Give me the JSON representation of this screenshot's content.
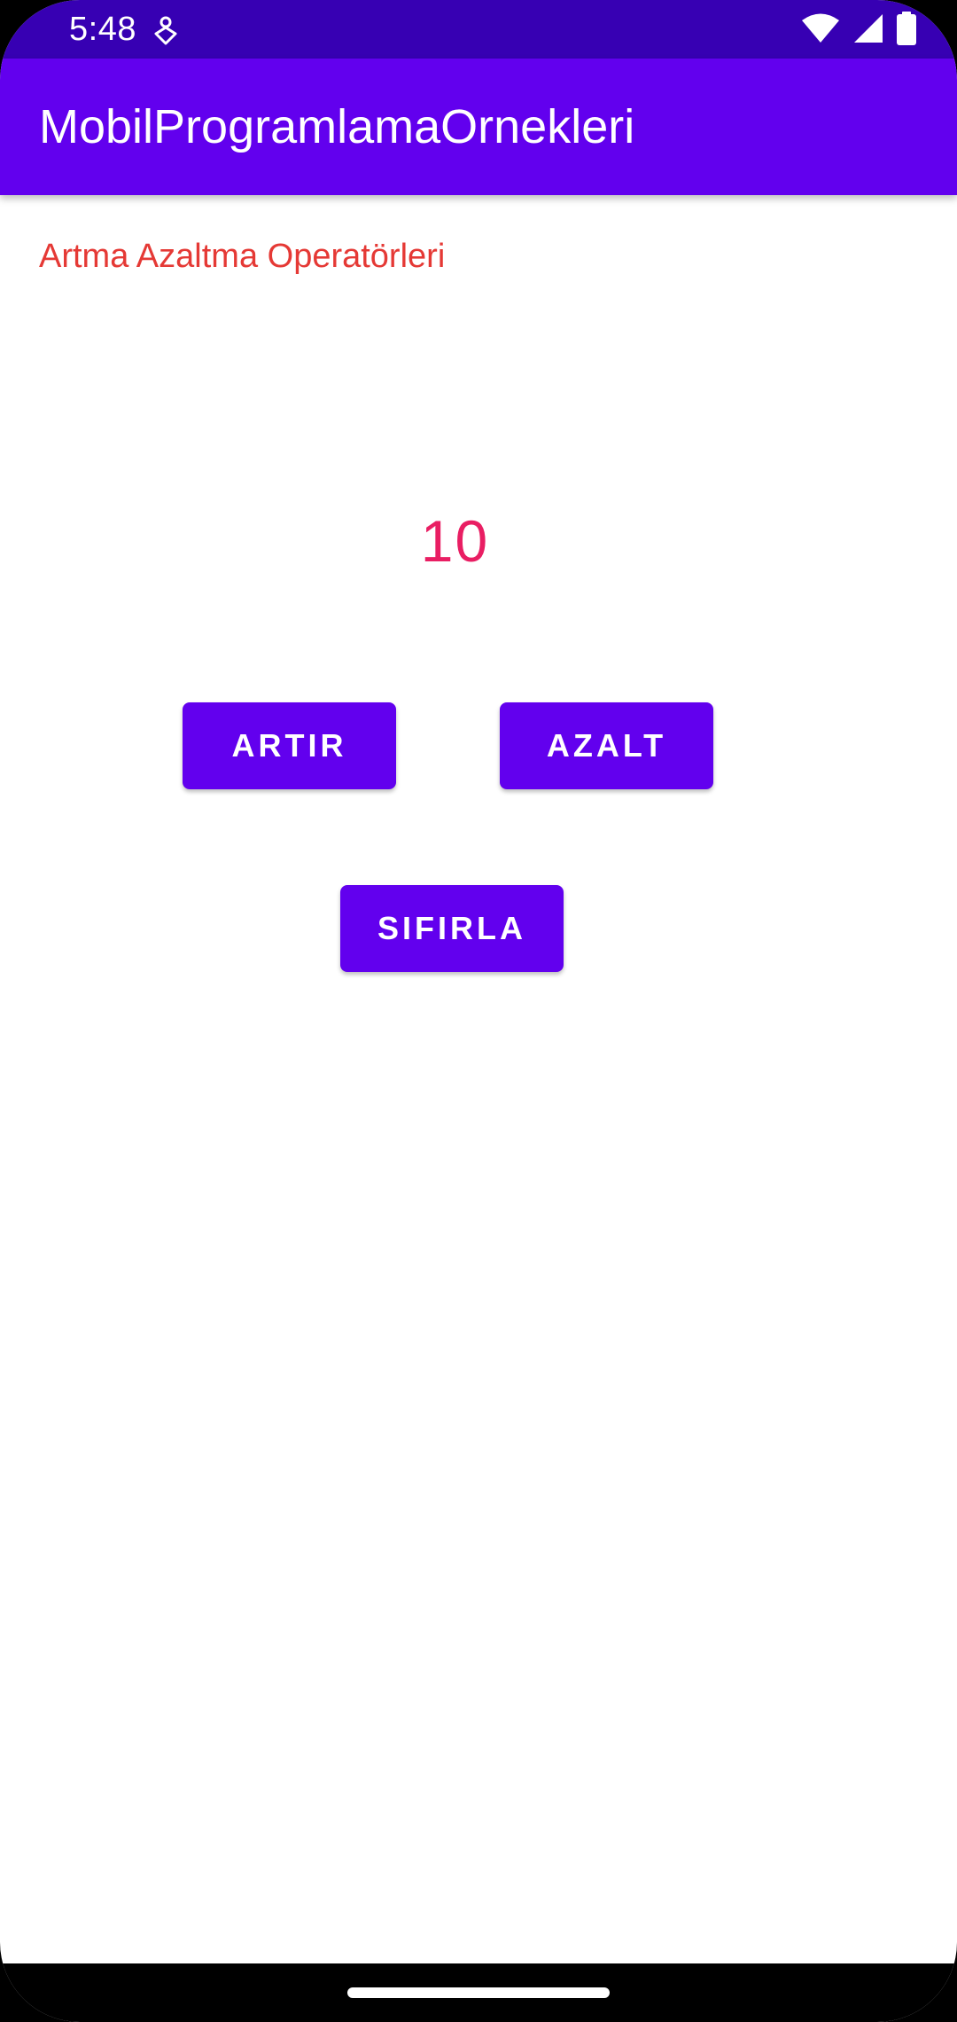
{
  "status_bar": {
    "time": "5:48",
    "icons": [
      "app-notification-icon",
      "wifi-icon",
      "signal-icon",
      "battery-icon"
    ],
    "background": "#3700b3"
  },
  "app_bar": {
    "title": "MobilProgramlamaOrnekleri",
    "background": "#6200ee"
  },
  "content": {
    "heading": "Artma Azaltma Operatörleri",
    "counter_value": "10",
    "buttons": {
      "increase": "ARTIR",
      "decrease": "AZALT",
      "reset": "SIFIRLA"
    }
  },
  "colors": {
    "accent": "#6200ee",
    "heading_text": "#e53935",
    "counter_text": "#e91e63"
  }
}
